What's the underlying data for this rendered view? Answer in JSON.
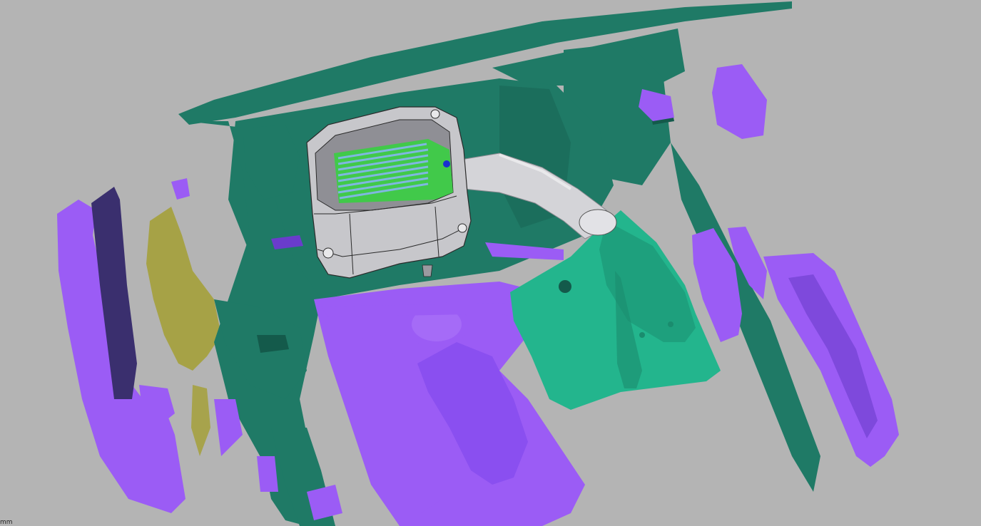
{
  "viewport": {
    "units": "mm",
    "background_color": "#b4b4b4"
  },
  "colors": {
    "body_scan": "#1f7a66",
    "body_scan_dark": "#145a4b",
    "engine_scan": "#9b5cf5",
    "engine_scan_dark": "#6a3ccc",
    "bumper_dark": "#3a2f6e",
    "cover_cad": "#23b58d",
    "airbox_cad": "#c7c7cb",
    "pipe_cad": "#d4d4d8",
    "filter_element": "#41c94a",
    "filter_pleats": "#7fb7e0",
    "debris_scan": "#a4a03a"
  },
  "scene_objects": {
    "body_shell": "scanned-body-shell",
    "engine": "scanned-engine",
    "front_bumper": "scanned-front-bumper",
    "airbox": "cad-airbox",
    "intake_pipe": "cad-intake-pipe",
    "battery_cover": "cad-battery-cover",
    "air_filter": "cad-air-filter",
    "radiator": "scanned-radiator"
  }
}
